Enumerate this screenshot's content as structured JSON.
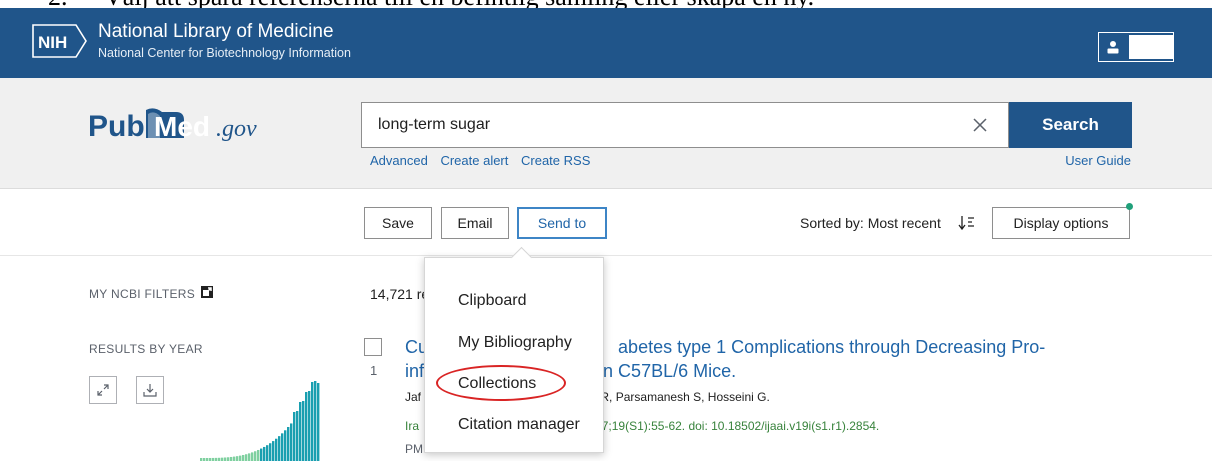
{
  "doc": {
    "step_number": "2.",
    "instruction": "Välj att spara referenserna till en befintlig samling eller skapa en ny."
  },
  "header": {
    "logo_text": "NIH",
    "org_name": "National Library of Medicine",
    "org_sub": "National Center for Biotechnology Information"
  },
  "pubmed": {
    "logo_pub": "Pub",
    "logo_med": "Med",
    "logo_gov": ".gov"
  },
  "search": {
    "query": "long-term sugar",
    "button_label": "Search",
    "links": [
      "Advanced",
      "Create alert",
      "Create RSS"
    ],
    "user_guide": "User Guide"
  },
  "actions": {
    "save": "Save",
    "email": "Email",
    "send_to": "Send to",
    "sorted_by": "Sorted by: Most recent",
    "display_options": "Display options"
  },
  "sidebar": {
    "filters_label": "MY NCBI FILTERS",
    "results_by_year": "RESULTS BY YEAR"
  },
  "results": {
    "count_text": "14,721 re",
    "item": {
      "number": "1",
      "title_line1": "Cu                                      abetes type 1 Complications through Decreasing Pro-",
      "title_line2": "inf                                   in C57BL/6 Mice.",
      "authors": "Jaf                                 ar S, Rezaei R, Parsamanesh S, Hosseini G.",
      "citation": "Ira                                  . 2020 May 17;19(S1):55-62. doi: 10.18502/ijaai.v19i(s1.r1).2854.",
      "pmid": "PMID: 32534511"
    }
  },
  "send_to_menu": {
    "items": [
      "Clipboard",
      "My Bibliography",
      "Collections",
      "Citation manager"
    ]
  },
  "colors": {
    "header_blue": "#20558a",
    "link_blue": "#2065a8",
    "citation_green": "#38833c",
    "annotation_red": "#d92424",
    "histogram_teal": "#1a9fb0"
  }
}
